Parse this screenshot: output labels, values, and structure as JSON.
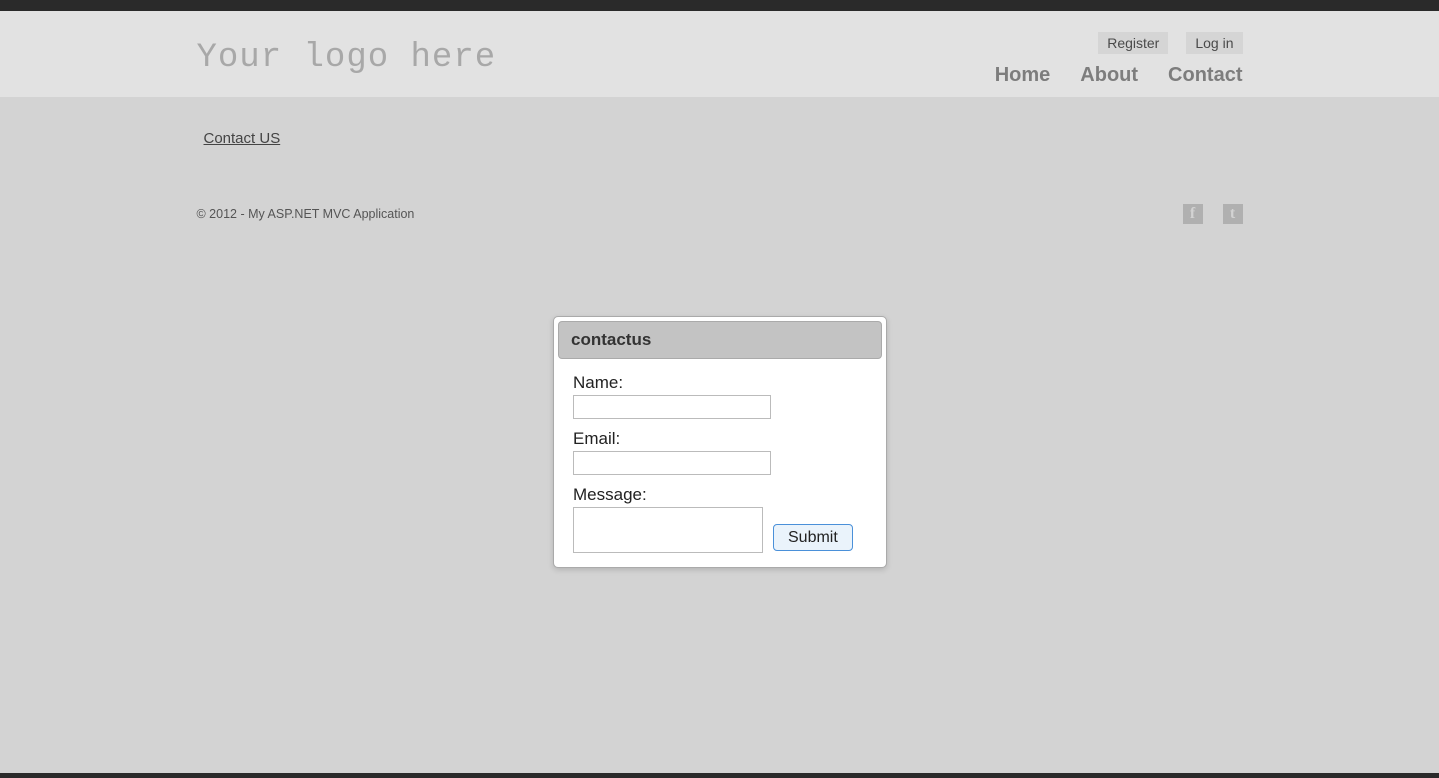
{
  "header": {
    "logo": "Your logo here",
    "auth": {
      "register": "Register",
      "login": "Log in"
    },
    "nav": {
      "home": "Home",
      "about": "About",
      "contact": "Contact"
    }
  },
  "subheader": {
    "contact_link": "Contact US"
  },
  "footer": {
    "copyright": "© 2012 - My ASP.NET MVC Application",
    "social": {
      "facebook": "f",
      "twitter": "t"
    }
  },
  "dialog": {
    "title": "contactus",
    "name_label": "Name:",
    "email_label": "Email:",
    "message_label": "Message:",
    "submit": "Submit",
    "name_value": "",
    "email_value": "",
    "message_value": ""
  }
}
